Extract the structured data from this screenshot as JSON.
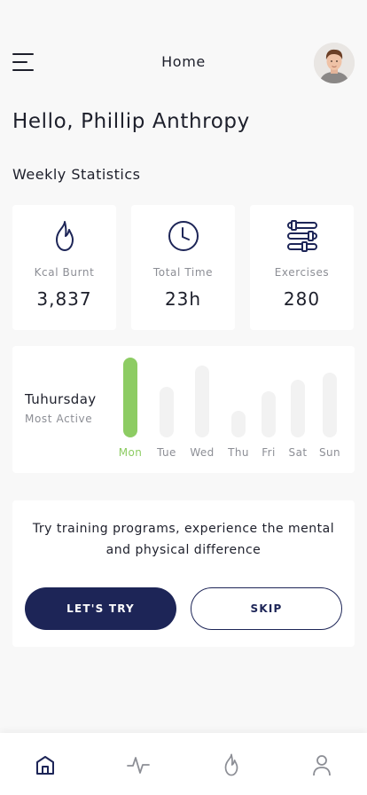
{
  "header": {
    "title": "Home"
  },
  "greeting": "Hello, Phillip Anthropy",
  "section_title": "Weekly Statistics",
  "stats": [
    {
      "icon": "flame-icon",
      "label": "Kcal Burnt",
      "value": "3,837"
    },
    {
      "icon": "clock-icon",
      "label": "Total Time",
      "value": "23h"
    },
    {
      "icon": "exercises-icon",
      "label": "Exercises",
      "value": "280"
    }
  ],
  "activity": {
    "most_active_day": "Tuhursday",
    "most_active_label": "Most Active",
    "days": [
      {
        "label": "Mon",
        "level": 1.0,
        "active": true
      },
      {
        "label": "Tue",
        "level": 0.63,
        "active": false
      },
      {
        "label": "Wed",
        "level": 0.9,
        "active": false
      },
      {
        "label": "Thu",
        "level": 0.33,
        "active": false
      },
      {
        "label": "Fri",
        "level": 0.58,
        "active": false
      },
      {
        "label": "Sat",
        "level": 0.72,
        "active": false
      },
      {
        "label": "Sun",
        "level": 0.81,
        "active": false
      }
    ]
  },
  "promo": {
    "text": "Try training programs, experience the mental and physical difference",
    "primary_label": "LET'S TRY",
    "secondary_label": "SKIP"
  },
  "tabbar": {
    "items": [
      {
        "icon": "home-icon",
        "active": true
      },
      {
        "icon": "activity-icon",
        "active": false
      },
      {
        "icon": "flame-icon",
        "active": false
      },
      {
        "icon": "profile-icon",
        "active": false
      }
    ]
  },
  "colors": {
    "accent_green": "#8dcc63",
    "primary_navy": "#1d2557",
    "muted_text": "#8c8e95",
    "background": "#f8f8f8"
  }
}
